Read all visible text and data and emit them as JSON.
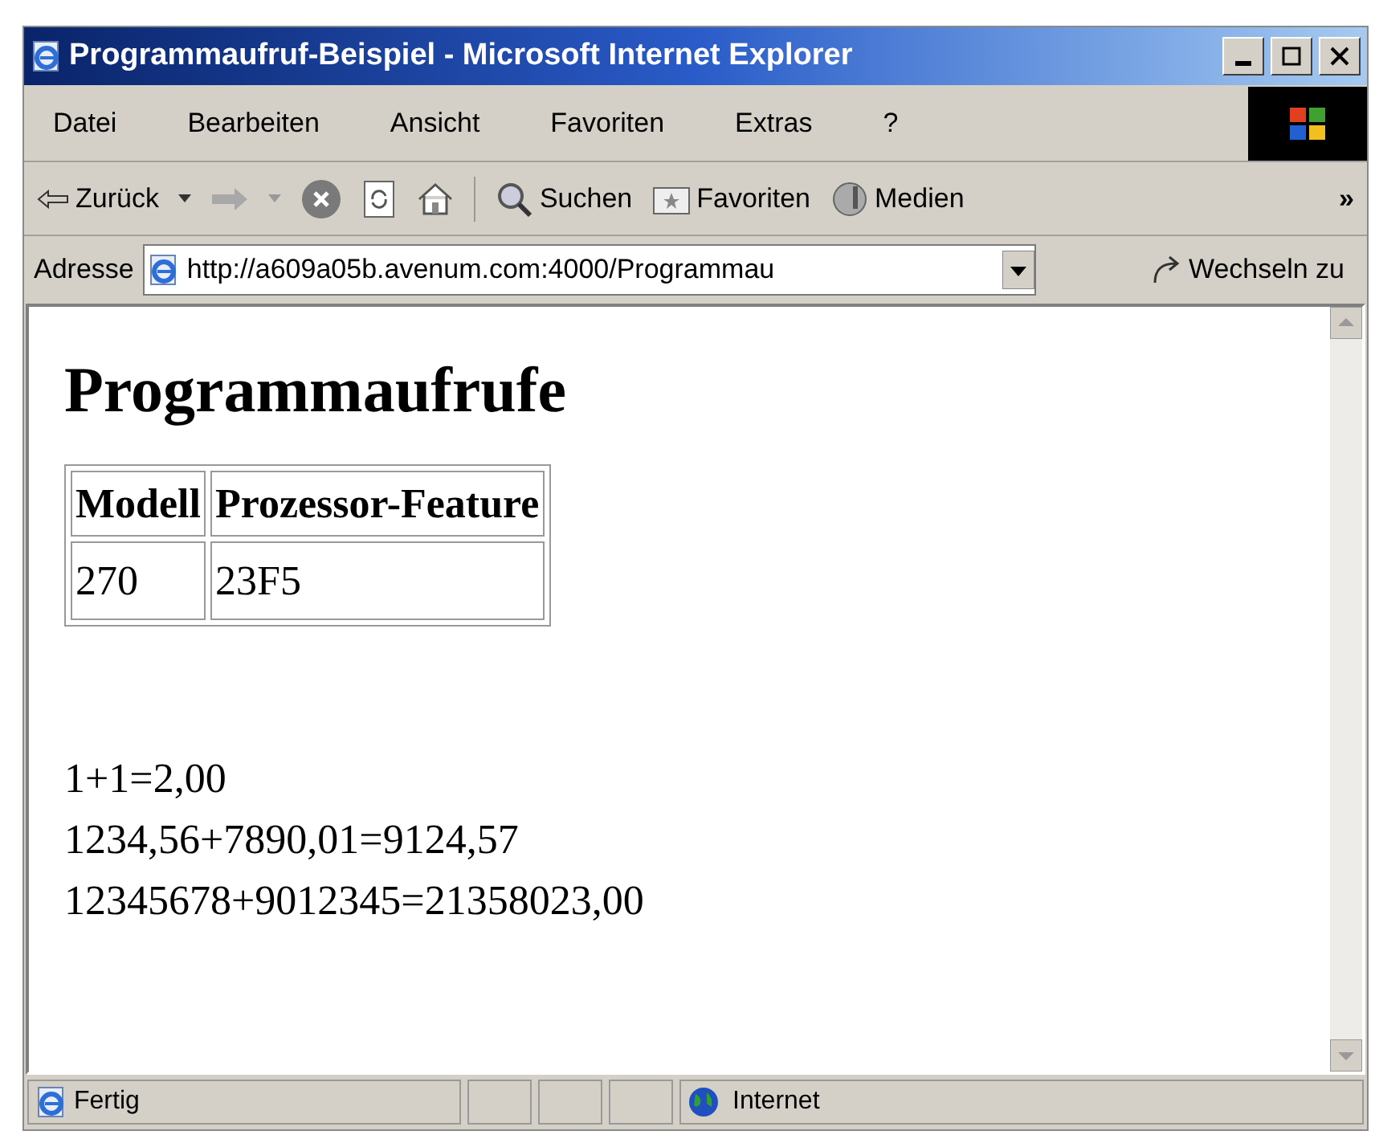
{
  "window": {
    "title": "Programmaufruf-Beispiel - Microsoft Internet Explorer"
  },
  "menu": [
    "Datei",
    "Bearbeiten",
    "Ansicht",
    "Favoriten",
    "Extras",
    "?"
  ],
  "toolbar": {
    "back": "Zurück",
    "search": "Suchen",
    "favorites": "Favoriten",
    "media": "Medien",
    "more": "»"
  },
  "address": {
    "label": "Adresse",
    "value": "http://a609a05b.avenum.com:4000/Programmau",
    "go": "Wechseln zu"
  },
  "page": {
    "heading": "Programmaufrufe",
    "table": {
      "columns": [
        "Modell",
        "Prozessor-Feature"
      ],
      "rows": [
        [
          "270",
          "23F5"
        ]
      ]
    },
    "lines": [
      "1+1=2,00",
      "1234,56+7890,01=9124,57",
      "12345678+9012345=21358023,00"
    ]
  },
  "status_bar": {
    "text": "Fertig",
    "zone": "Internet"
  }
}
